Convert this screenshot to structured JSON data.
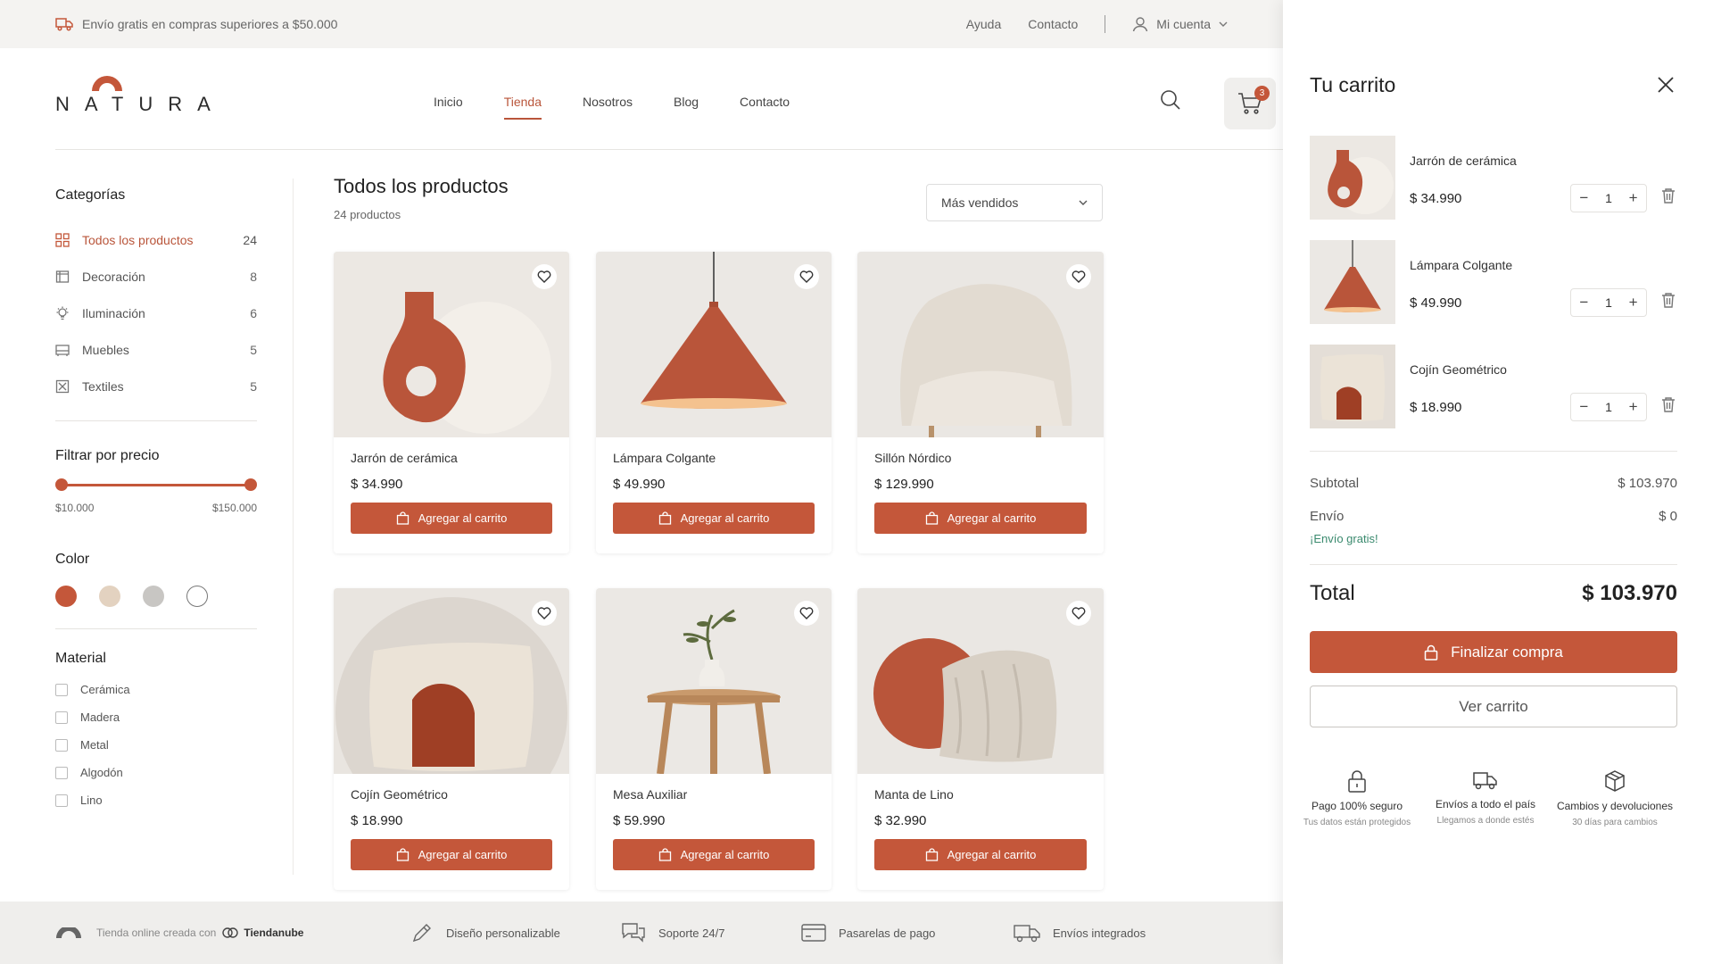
{
  "topbar": {
    "promo": "Envío gratis en compras superiores a $50.000",
    "help": "Ayuda",
    "contact": "Contacto",
    "account": "Mi cuenta"
  },
  "brand": {
    "name": "NATURA",
    "accent_color": "#c4573a"
  },
  "nav": {
    "items": [
      "Inicio",
      "Tienda",
      "Nosotros",
      "Blog",
      "Contacto"
    ],
    "active": "Tienda"
  },
  "cart_badge": "3",
  "sidebar": {
    "categories_title": "Categorías",
    "categories": [
      {
        "label": "Todos los productos",
        "count": "24",
        "icon": "grid-icon"
      },
      {
        "label": "Decoración",
        "count": "8",
        "icon": "frame-icon"
      },
      {
        "label": "Iluminación",
        "count": "6",
        "icon": "bulb-icon"
      },
      {
        "label": "Muebles",
        "count": "5",
        "icon": "sofa-icon"
      },
      {
        "label": "Textiles",
        "count": "5",
        "icon": "textile-icon"
      }
    ],
    "price_title": "Filtrar por precio",
    "price_min": "$10.000",
    "price_max": "$150.000",
    "color_title": "Color",
    "colors": [
      "#c4573a",
      "#e3d2c0",
      "#c8c6c3",
      "#ffffff"
    ],
    "material_title": "Material",
    "materials": [
      "Cerámica",
      "Madera",
      "Metal",
      "Algodón",
      "Lino"
    ]
  },
  "main": {
    "title": "Todos los productos",
    "count": "24 productos",
    "sort": "Más vendidos",
    "add_label": "Agregar al carrito",
    "products": [
      {
        "name": "Jarrón de cerámica",
        "price": "$ 34.990"
      },
      {
        "name": "Lámpara Colgante",
        "price": "$ 49.990"
      },
      {
        "name": "Sillón Nórdico",
        "price": "$ 129.990"
      },
      {
        "name": "Cojín Geométrico",
        "price": "$ 18.990"
      },
      {
        "name": "Mesa Auxiliar",
        "price": "$ 59.990"
      },
      {
        "name": "Manta de Lino",
        "price": "$ 32.990"
      }
    ]
  },
  "footer": {
    "credit": "Tienda online creada con",
    "platform": "Tiendanube",
    "features": [
      "Diseño personalizable",
      "Soporte 24/7",
      "Pasarelas de pago",
      "Envíos integrados"
    ]
  },
  "cart": {
    "title": "Tu carrito",
    "items": [
      {
        "name": "Jarrón de cerámica",
        "price": "$ 34.990",
        "qty": "1"
      },
      {
        "name": "Lámpara Colgante",
        "price": "$ 49.990",
        "qty": "1"
      },
      {
        "name": "Cojín Geométrico",
        "price": "$ 18.990",
        "qty": "1"
      }
    ],
    "subtotal_label": "Subtotal",
    "subtotal": "$ 103.970",
    "shipping_label": "Envío",
    "shipping": "$ 0",
    "free_shipping": "¡Envío gratis!",
    "total_label": "Total",
    "total": "$ 103.970",
    "checkout": "Finalizar compra",
    "view_cart": "Ver carrito",
    "features": [
      {
        "title": "Pago 100% seguro",
        "sub": "Tus datos están protegidos"
      },
      {
        "title": "Envíos a todo el país",
        "sub": "Llegamos a donde estés"
      },
      {
        "title": "Cambios y devoluciones",
        "sub": "30 días para cambios"
      }
    ]
  }
}
